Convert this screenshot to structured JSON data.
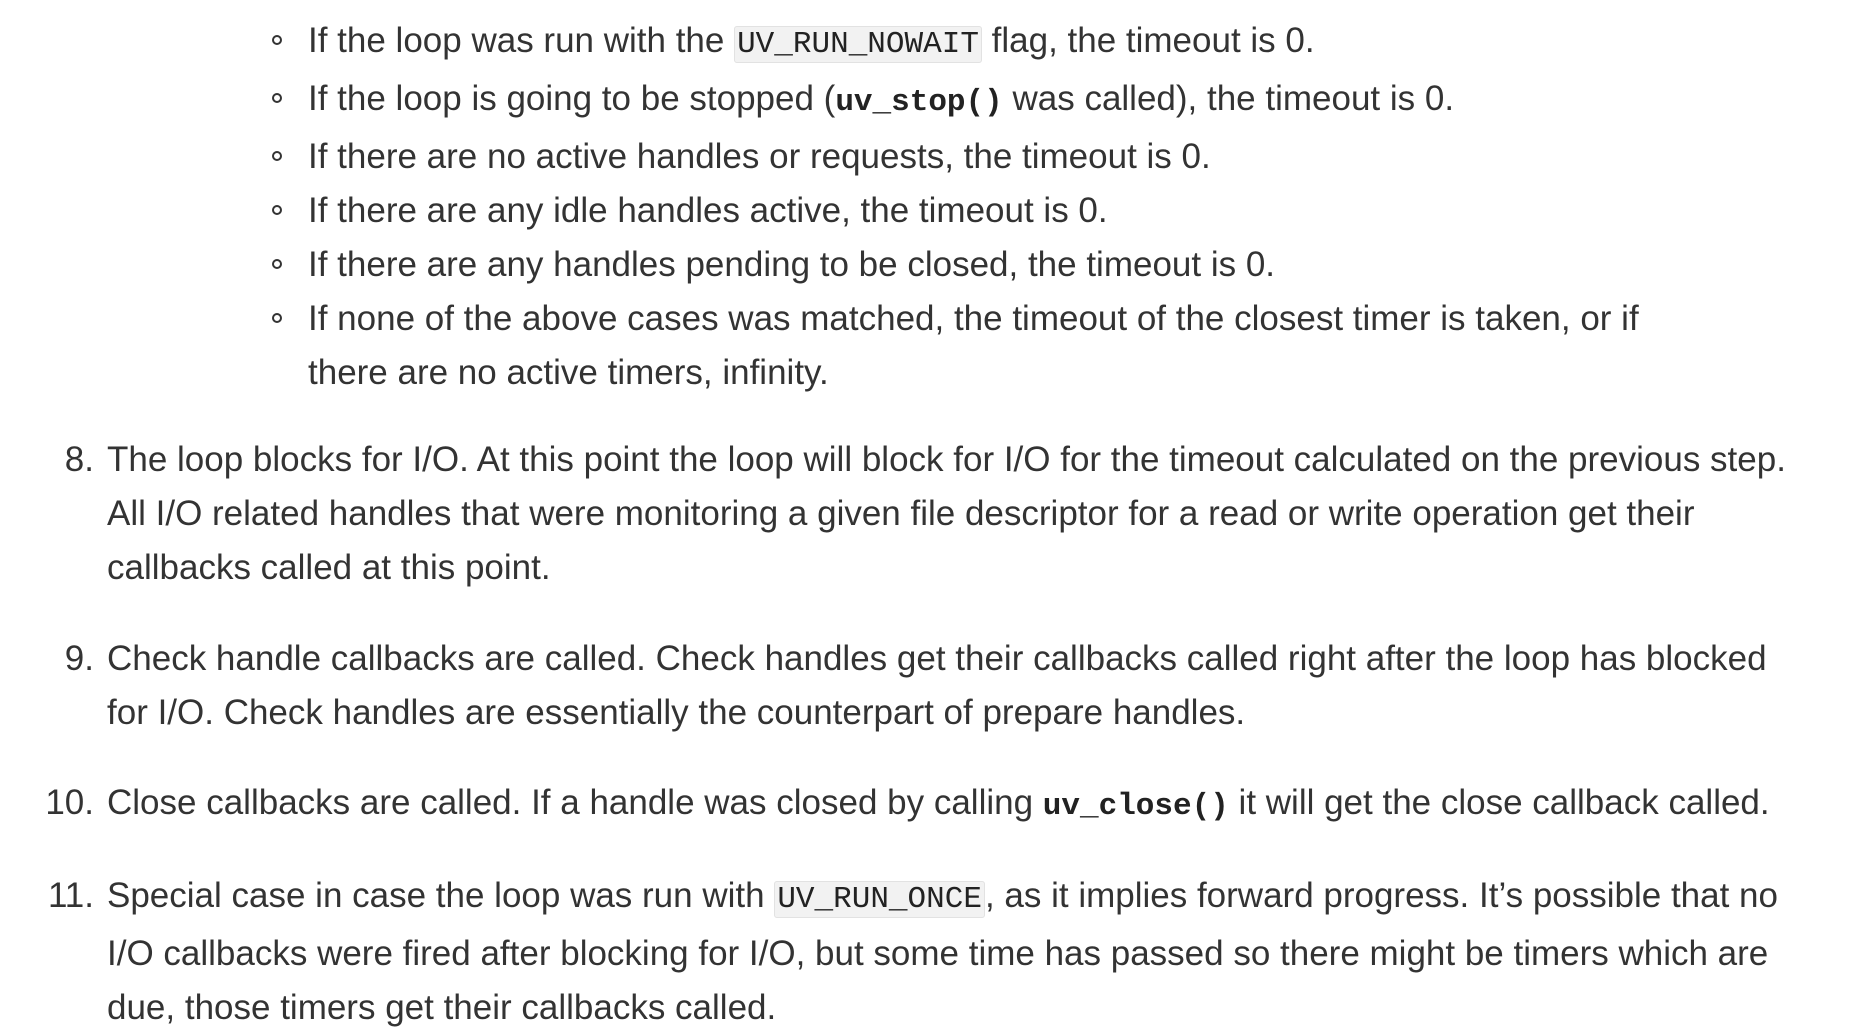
{
  "sub_items": [
    {
      "pre": "If the loop was run with the ",
      "code": "UV_RUN_NOWAIT",
      "post": " flag, the timeout is 0."
    },
    {
      "pre": "If the loop is going to be stopped (",
      "code": "uv_stop()",
      "post": " was called), the timeout is 0."
    },
    {
      "text": "If there are no active handles or requests, the timeout is 0."
    },
    {
      "text": "If there are any idle handles active, the timeout is 0."
    },
    {
      "text": "If there are any handles pending to be closed, the timeout is 0."
    },
    {
      "line1": "If none of the above cases was matched, the timeout of the closest timer is taken, or if",
      "line2": "there are no active timers, infinity."
    }
  ],
  "steps": [
    {
      "num": "8.",
      "lines": [
        "The loop blocks for I/O. At this point the loop will block for I/O for the timeout calculated on the previous step.",
        "All I/O related handles that were monitoring a given file descriptor for a read or write operation get their",
        "callbacks called at this point."
      ]
    },
    {
      "num": "9.",
      "lines": [
        "Check handle callbacks are called. Check handles get their callbacks called right after the loop has blocked",
        "for I/O. Check handles are essentially the counterpart of prepare handles."
      ]
    },
    {
      "num": "10.",
      "pre": "Close callbacks are called. If a handle was closed by calling ",
      "code": "uv_close()",
      "post": " it will get the close callback called."
    },
    {
      "num": "11.",
      "pre": "Special case in case the loop was run with ",
      "code": "UV_RUN_ONCE",
      "post": ", as it implies forward progress. It’s possible that no",
      "lines": [
        "I/O callbacks were fired after blocking for I/O, but some time has passed so there might be timers which are",
        "due, those timers get their callbacks called."
      ]
    }
  ]
}
